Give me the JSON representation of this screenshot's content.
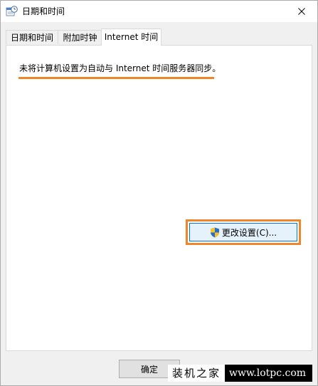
{
  "window": {
    "title": "日期和时间",
    "close_label": "✕"
  },
  "tabs": [
    {
      "label": "日期和时间",
      "active": false
    },
    {
      "label": "附加时钟",
      "active": false
    },
    {
      "label": "Internet 时间",
      "active": true
    }
  ],
  "panel": {
    "status_text": "未将计算机设置为自动与 Internet 时间服务器同步。",
    "change_button_label": "更改设置(C)..."
  },
  "footer": {
    "ok_label": "确定"
  },
  "watermark": {
    "left_text": "装机之家",
    "right_text": "www.lotpc.com"
  },
  "colors": {
    "highlight": "#f0862a",
    "button_accent": "#0078d7"
  },
  "icons": {
    "app": "clock-calendar-icon",
    "close": "close-icon",
    "shield": "uac-shield-icon"
  }
}
